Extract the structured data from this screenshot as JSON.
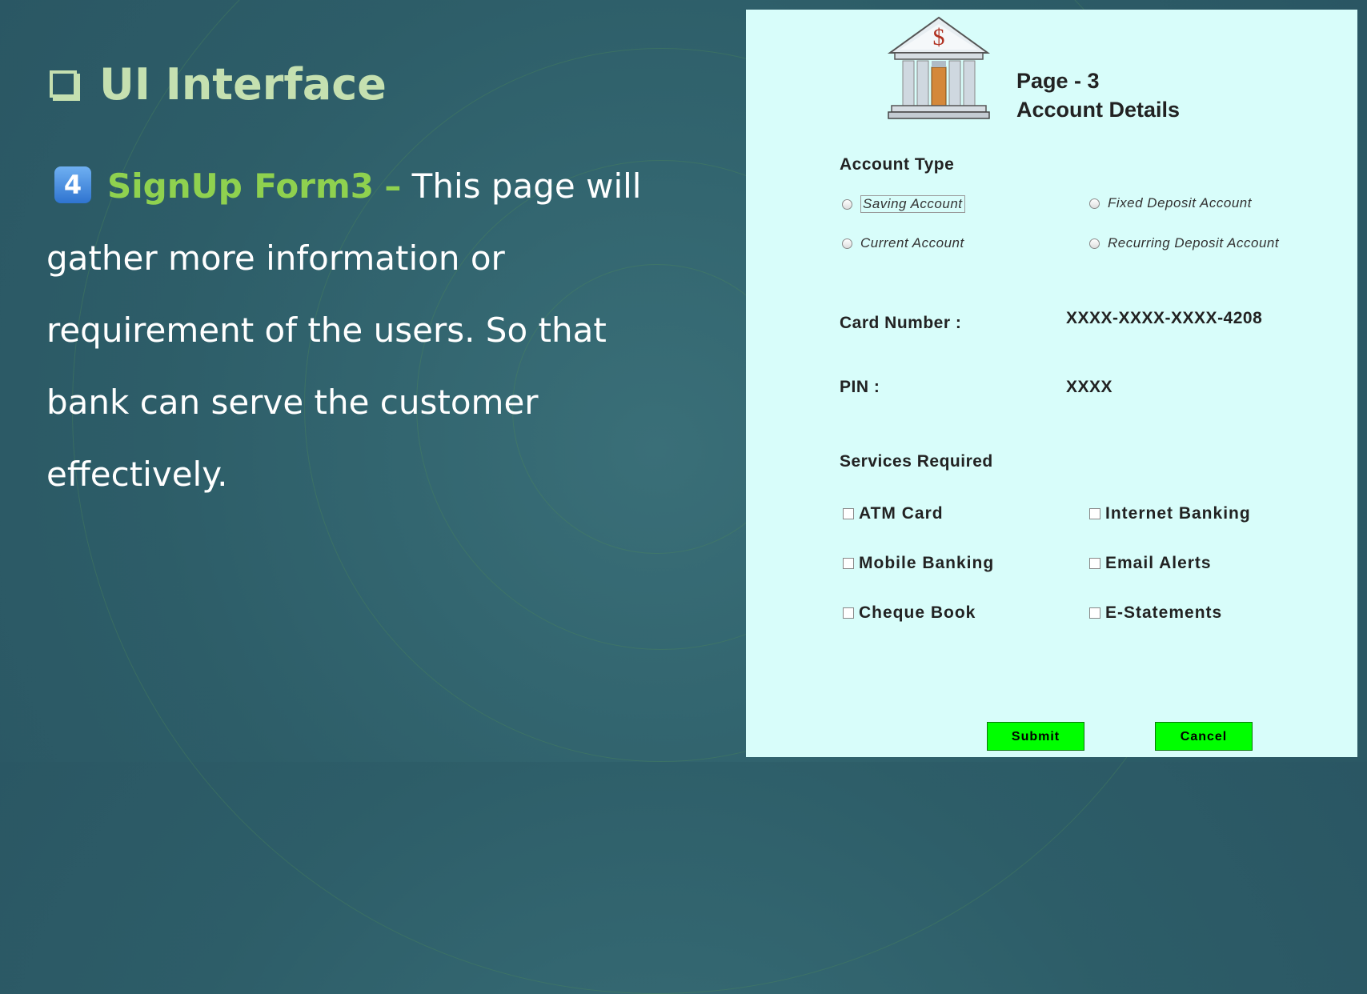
{
  "slide": {
    "heading": "UI Interface",
    "step_number": "4",
    "form_name": "SignUp Form3",
    "dash": "–",
    "line1": "This page will",
    "line2": "gather more information or",
    "line3": "requirement of the users. So that",
    "line4": "bank can serve the customer",
    "line5": "effectively."
  },
  "form": {
    "page_number": "Page - 3",
    "page_title": "Account Details",
    "account_type_label": "Account Type",
    "account_types": [
      "Saving Account",
      "Fixed Deposit Account",
      "Current Account",
      "Recurring Deposit Account"
    ],
    "card_number_label": "Card Number :",
    "card_number_value": "XXXX-XXXX-XXXX-4208",
    "pin_label": "PIN :",
    "pin_value": "XXXX",
    "services_label": "Services Required",
    "services": [
      "ATM Card",
      "Internet Banking",
      "Mobile Banking",
      "Email Alerts",
      "Cheque Book",
      "E-Statements"
    ],
    "submit_label": "Submit",
    "cancel_label": "Cancel"
  },
  "colors": {
    "heading": "#c5e0b0",
    "form_name": "#8fd14f",
    "panel_bg": "#d8fdfa",
    "button_bg": "#00ff00"
  }
}
